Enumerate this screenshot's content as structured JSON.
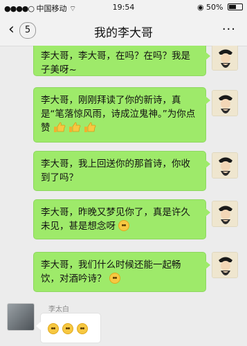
{
  "status_bar": {
    "carrier": "中国移动",
    "time": "19:54",
    "battery": "50%",
    "battery_level": 0.5
  },
  "nav": {
    "unread_count": "5",
    "title": "我的李大哥",
    "more": "···"
  },
  "messages": [
    {
      "text": "李大哥，李大哥，在吗？在吗？我是子美呀~"
    },
    {
      "text": "李大哥，刚刚拜读了你的新诗，真是“笔落惊风雨，诗成泣鬼神。”为你点赞"
    },
    {
      "text": "李大哥，我上回送你的那首诗，你收到了吗？"
    },
    {
      "text": "李大哥，昨晚又梦见你了，真是许久未见，甚是想念呀"
    },
    {
      "text": "李大哥，我们什么时候还能一起畅饮，对酒吟诗？"
    }
  ],
  "reply": {
    "sender": "李太白"
  },
  "icons": {
    "signal": "signal-dots-icon",
    "wifi": "wifi-icon",
    "lock": "rotation-lock-icon",
    "battery": "battery-icon",
    "back": "chevron-left-icon",
    "more": "more-dots-icon",
    "thumbs": "thumbs-up-icon",
    "emoji": "smile-emoji-icon"
  },
  "colors": {
    "bubble_green": "#9eea6a",
    "nav_bg": "#f2f2f2",
    "chat_bg": "#ececec"
  }
}
